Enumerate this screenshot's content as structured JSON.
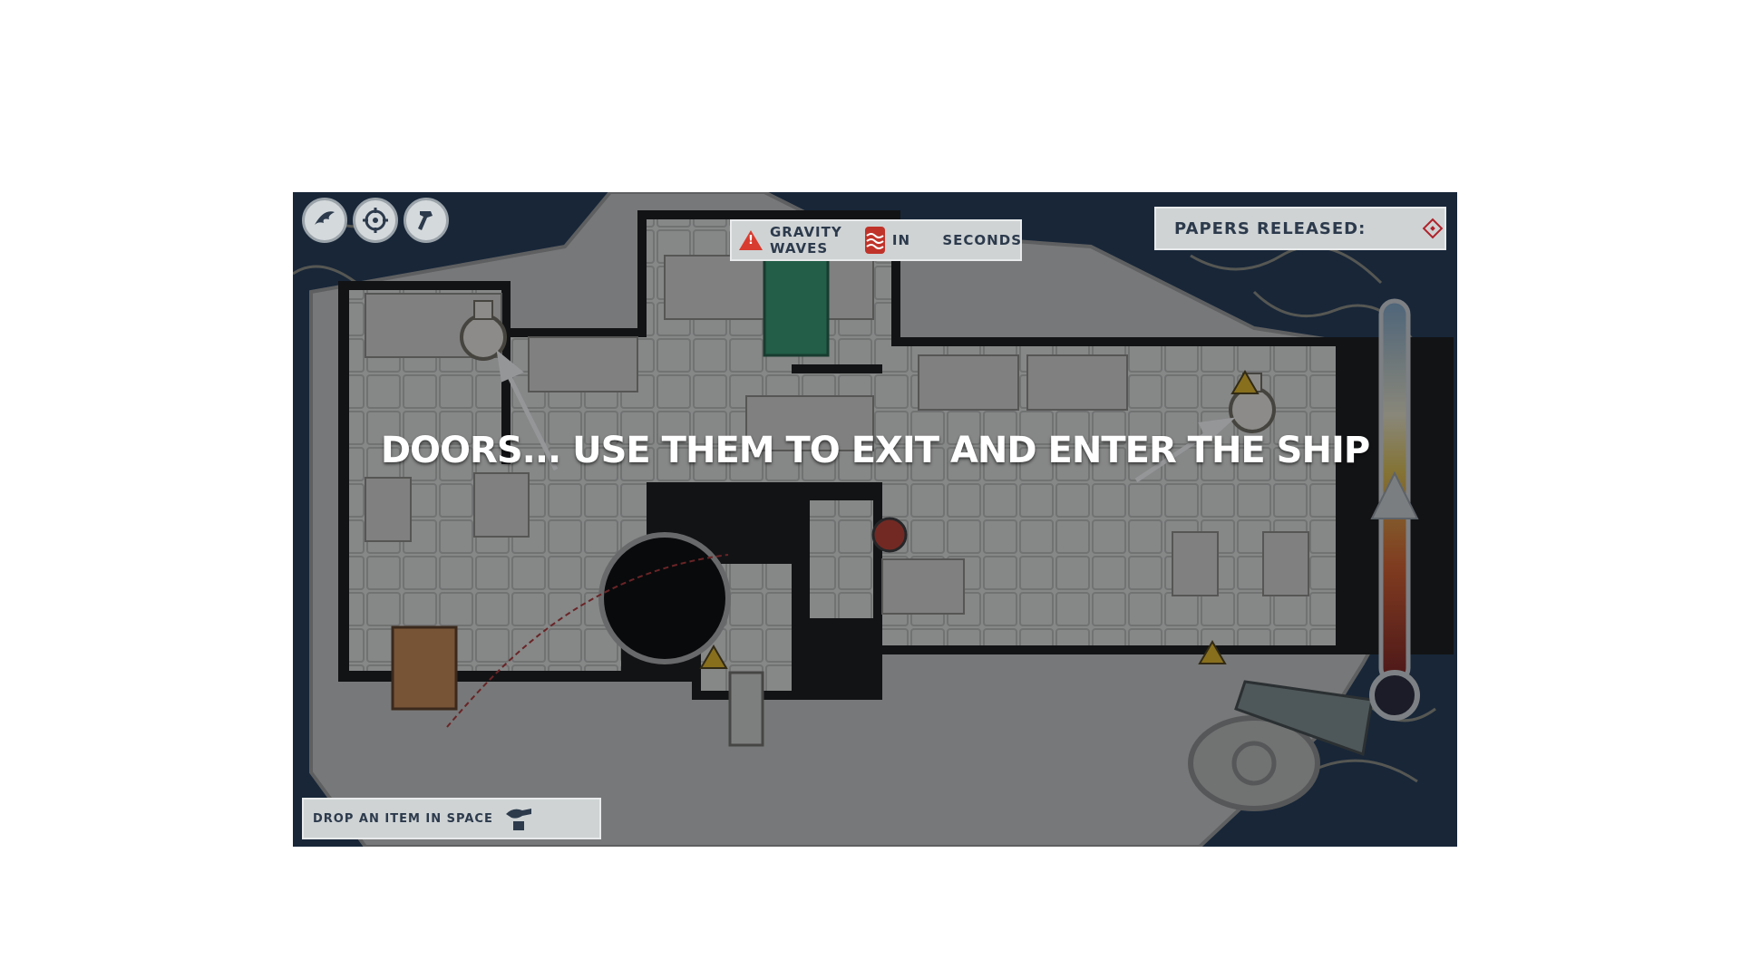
{
  "toolbar": {
    "buttons": [
      {
        "icon": "wing-icon",
        "label": ""
      },
      {
        "icon": "target-icon",
        "label": ""
      },
      {
        "icon": "hammer-icon",
        "label": ""
      }
    ]
  },
  "gravity_warning": {
    "text": "Gravity waves",
    "in_text": "in",
    "seconds_text": "seconds",
    "alert_color": "#d83b2f",
    "wave_color": "#c0332a"
  },
  "papers": {
    "label": "Papers released:",
    "icon": "diamond-icon",
    "icon_color": "#b0222a"
  },
  "drop": {
    "label": "Drop an item in space",
    "icon": "hand-drop-icon"
  },
  "tutorial": {
    "text": "Doors... use them to exit and enter the ship"
  },
  "temperature_gauge": {
    "level": 0.58,
    "colors": [
      "#7ea6c8",
      "#e0c04a",
      "#d85a25",
      "#7a1818"
    ]
  }
}
